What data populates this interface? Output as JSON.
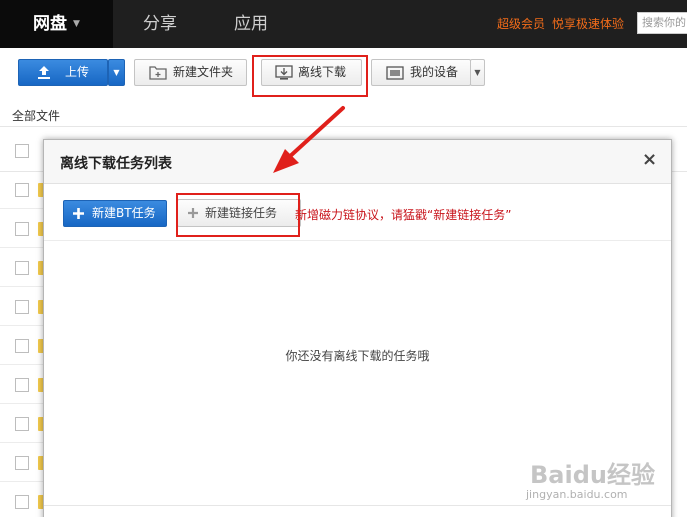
{
  "nav": {
    "wangpan": "网盘",
    "share": "分享",
    "app": "应用",
    "vip": "超级会员",
    "speed": "悦享极速体验",
    "search_placeholder": "搜索你的"
  },
  "toolbar": {
    "upload": "上传",
    "new_folder": "新建文件夹",
    "offline_download": "离线下载",
    "my_devices": "我的设备"
  },
  "filelist": {
    "all_files": "全部文件"
  },
  "dialog": {
    "title": "离线下载任务列表",
    "close": "×",
    "new_bt": "新建BT任务",
    "new_link": "新建链接任务",
    "hint": "新增磁力链协议，请猛戳“新建链接任务”",
    "empty": "你还没有离线下载的任务哦"
  },
  "watermark": {
    "brand": "Baidu经验",
    "url": "jingyan.baidu.com"
  },
  "colors": {
    "nav_bg": "#1f1f1f",
    "primary_blue": "#1f74d2",
    "vip_orange": "#f26c1a",
    "highlight_red": "#e0201b",
    "hint_red": "#c8141b"
  }
}
